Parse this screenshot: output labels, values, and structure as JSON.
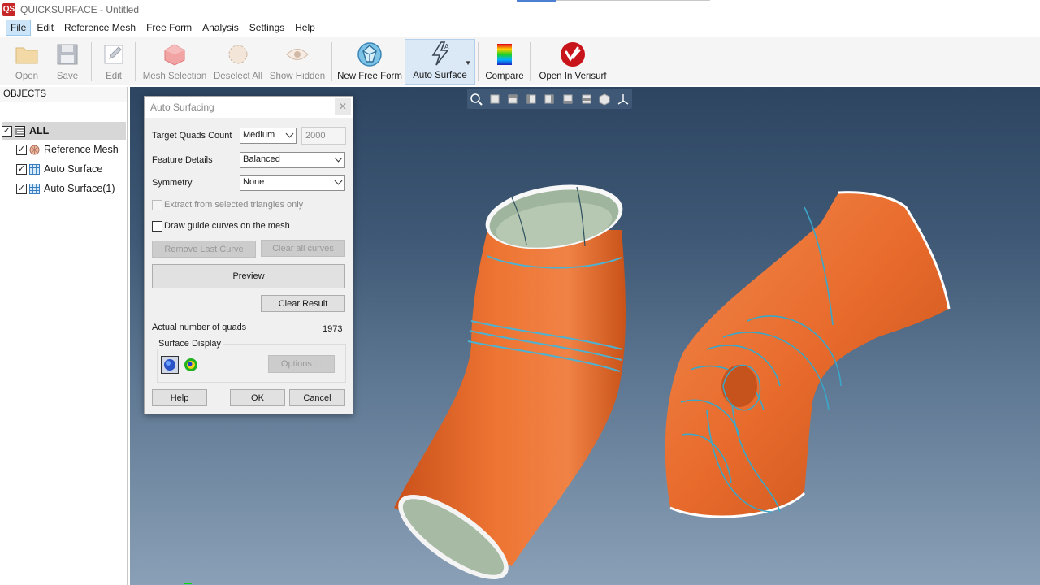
{
  "window": {
    "title": "QUICKSURFACE - Untitled",
    "logo": "QS"
  },
  "menu": [
    "File",
    "Edit",
    "Reference Mesh",
    "Free Form",
    "Analysis",
    "Settings",
    "Help"
  ],
  "toolbar": {
    "open": "Open",
    "save": "Save",
    "edit": "Edit",
    "mesh_selection": "Mesh Selection",
    "deselect_all": "Deselect All",
    "show_hidden": "Show Hidden",
    "new_free_form": "New Free Form",
    "auto_surface": "Auto Surface",
    "compare": "Compare",
    "open_in_verisurf": "Open In Verisurf"
  },
  "objects": {
    "header": "OBJECTS",
    "items": [
      {
        "label": "ALL",
        "checked": true,
        "icon": "list-icon"
      },
      {
        "label": "Reference Mesh",
        "checked": true,
        "icon": "mesh-icon"
      },
      {
        "label": "Auto Surface",
        "checked": true,
        "icon": "grid-icon"
      },
      {
        "label": "Auto Surface(1)",
        "checked": true,
        "icon": "grid-icon"
      }
    ]
  },
  "dialog": {
    "title": "Auto Surfacing",
    "target_quads_label": "Target Quads Count",
    "target_quads_value": "Medium",
    "target_quads_number": "2000",
    "feature_details_label": "Feature Details",
    "feature_details_value": "Balanced",
    "symmetry_label": "Symmetry",
    "symmetry_value": "None",
    "extract_label": "Extract from selected triangles only",
    "draw_curves_label": "Draw guide curves on the mesh",
    "remove_last_curve": "Remove Last Curve",
    "clear_all_curves": "Clear all curves",
    "preview": "Preview",
    "clear_result": "Clear Result",
    "actual_quads_label": "Actual number of quads",
    "actual_quads_value": "1973",
    "surface_display_label": "Surface Display",
    "options": "Options ...",
    "help": "Help",
    "ok": "OK",
    "cancel": "Cancel"
  },
  "colors": {
    "surface": "#ea6a2c",
    "curve": "#3aa7c9",
    "inner": "#9db59a",
    "viewport_top": "#2d4561",
    "viewport_bottom": "#8aa0b7"
  }
}
